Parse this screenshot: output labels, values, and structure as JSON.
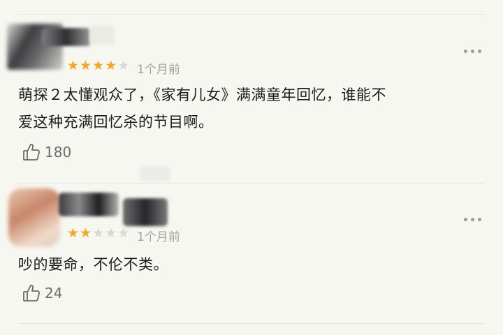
{
  "comments": [
    {
      "rating": 4,
      "rating_max": 5,
      "time": "1个月前",
      "content_lines": [
        "萌探２太懂观众了，《家有儿女》满满童年回忆，谁能不",
        "爱这种充满回忆杀的节目啊。"
      ],
      "likes": "180",
      "icons": {
        "like": "thumbs-up-icon",
        "more": "more-options-icon"
      }
    },
    {
      "rating": 2,
      "rating_max": 5,
      "time": "1个月前",
      "content_lines": [
        "吵的要命，不伦不类。"
      ],
      "likes": "24",
      "icons": {
        "like": "thumbs-up-icon",
        "more": "more-options-icon"
      }
    }
  ],
  "colors": {
    "star_active": "#f5a623",
    "star_inactive": "#d9d9d4",
    "background": "#f7f7f2"
  }
}
